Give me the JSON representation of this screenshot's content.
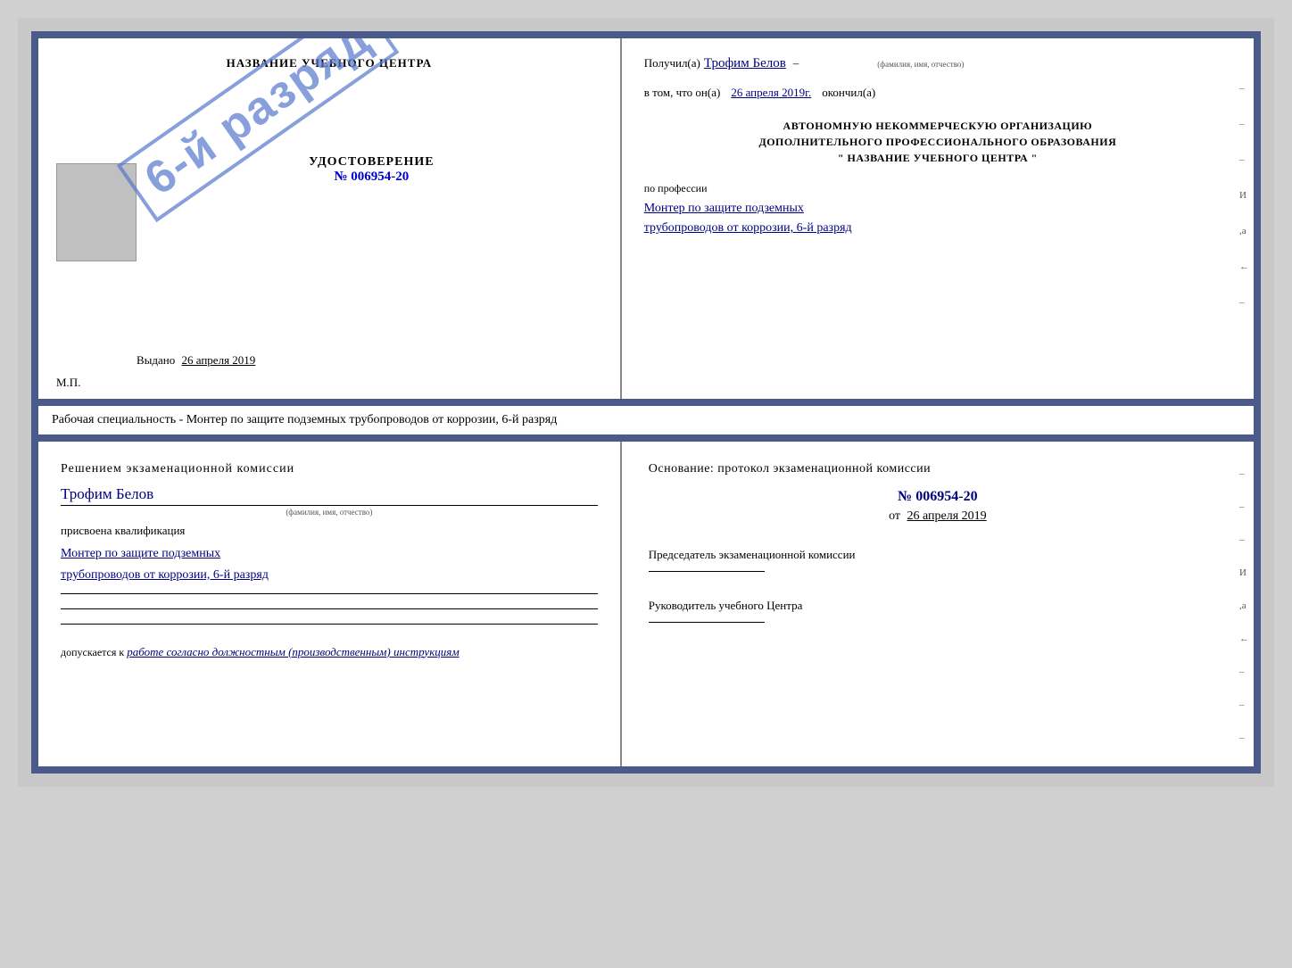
{
  "top_cert": {
    "left": {
      "title": "НАЗВАНИЕ УЧЕБНОГО ЦЕНТРА",
      "stamp_text": "6-й разряд",
      "udostoverenie": "УДОСТОВЕРЕНИЕ",
      "number": "№ 006954-20",
      "issued_label": "Выдано",
      "issued_date": "26 апреля 2019",
      "mp": "М.П."
    },
    "right": {
      "received_label": "Получил(а)",
      "recipient_name": "Трофим Белов",
      "fio_sub": "(фамилия, имя, отчество)",
      "dash": "–",
      "in_that_label": "в том, что он(а)",
      "completion_date": "26 апреля 2019г.",
      "completed_label": "окончил(а)",
      "org_line1": "АВТОНОМНУЮ НЕКОММЕРЧЕСКУЮ ОРГАНИЗАЦИЮ",
      "org_line2": "ДОПОЛНИТЕЛЬНОГО ПРОФЕССИОНАЛЬНОГО ОБРАЗОВАНИЯ",
      "org_line3": "\"  НАЗВАНИЕ УЧЕБНОГО ЦЕНТРА  \"",
      "profession_label": "по профессии",
      "profession_text": "Монтер по защите подземных трубопроводов от коррозии, 6-й разряд",
      "dashes": [
        "-",
        "-",
        "-",
        "И",
        ",а",
        "←",
        "-"
      ]
    }
  },
  "between_text": "Рабочая специальность - Монтер по защите подземных трубопроводов от коррозии, 6-й разряд",
  "bottom_cert": {
    "left": {
      "decision": "Решением экзаменационной комиссии",
      "name": "Трофим Белов",
      "fio_sub": "(фамилия, имя, отчество)",
      "assigned": "присвоена квалификация",
      "qualification": "Монтер по защите подземных трубопроводов от коррозии, 6-й разряд",
      "допускается_label": "допускается к",
      "допускается_text": "работе согласно должностным (производственным) инструкциям"
    },
    "right": {
      "osnov_label": "Основание: протокол экзаменационной комиссии",
      "prot_number": "№ 006954-20",
      "prot_date_prefix": "от",
      "prot_date": "26 апреля 2019",
      "chairman_label": "Председатель экзаменационной комиссии",
      "director_label": "Руководитель учебного Центра",
      "dashes": [
        "-",
        "-",
        "-",
        "И",
        ",а",
        "←",
        "-",
        "-",
        "-",
        "-"
      ]
    }
  }
}
